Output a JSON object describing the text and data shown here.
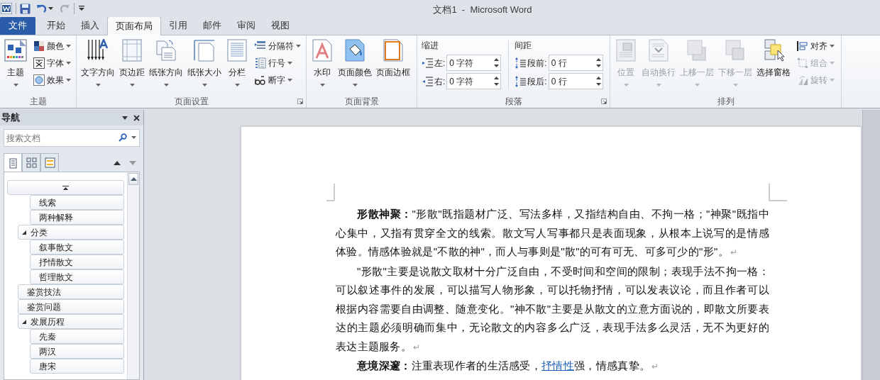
{
  "window": {
    "title": "文档1  -  Microsoft Word"
  },
  "file_tab": "文件",
  "tabs": [
    {
      "label": "开始",
      "selected": false
    },
    {
      "label": "插入",
      "selected": false
    },
    {
      "label": "页面布局",
      "selected": true
    },
    {
      "label": "引用",
      "selected": false
    },
    {
      "label": "邮件",
      "selected": false
    },
    {
      "label": "审阅",
      "selected": false
    },
    {
      "label": "视图",
      "selected": false
    }
  ],
  "ribbon": {
    "groups": [
      {
        "kind": "buttons",
        "label": "主题",
        "launcher": false,
        "buttons": [
          {
            "kind": "large",
            "label": "主题",
            "dropdown": true,
            "disabled": false
          },
          {
            "kind": "small",
            "label": "颜色",
            "dropdown": true,
            "disabled": false
          },
          {
            "kind": "small",
            "label": "字体",
            "dropdown": true,
            "disabled": false
          },
          {
            "kind": "small",
            "label": "效果",
            "dropdown": true,
            "disabled": false
          }
        ]
      },
      {
        "kind": "buttons",
        "label": "页面设置",
        "launcher": true,
        "buttons": [
          {
            "kind": "large",
            "label": "文字方向",
            "dropdown": true,
            "disabled": false
          },
          {
            "kind": "large",
            "label": "页边距",
            "dropdown": true,
            "disabled": false
          },
          {
            "kind": "large",
            "label": "纸张方向",
            "dropdown": true,
            "disabled": false
          },
          {
            "kind": "large",
            "label": "纸张大小",
            "dropdown": true,
            "disabled": false
          },
          {
            "kind": "large",
            "label": "分栏",
            "dropdown": true,
            "disabled": false
          },
          {
            "kind": "small",
            "label": "分隔符",
            "dropdown": true,
            "disabled": false
          },
          {
            "kind": "small",
            "label": "行号",
            "dropdown": true,
            "disabled": false
          },
          {
            "kind": "small",
            "label": "断字",
            "dropdown": true,
            "disabled": false
          }
        ]
      },
      {
        "kind": "buttons",
        "label": "页面背景",
        "launcher": false,
        "buttons": [
          {
            "kind": "large",
            "label": "水印",
            "dropdown": true,
            "disabled": false
          },
          {
            "kind": "large",
            "label": "页面颜色",
            "dropdown": true,
            "disabled": false
          },
          {
            "kind": "large",
            "label": "页面边框",
            "dropdown": false,
            "disabled": false
          }
        ]
      },
      {
        "kind": "paragraph",
        "label": "段落",
        "launcher": true,
        "sections": [
          {
            "heading": "缩进",
            "fields": [
              {
                "label": "左:",
                "value": "0 字符"
              },
              {
                "label": "右:",
                "value": "0 字符"
              }
            ]
          },
          {
            "heading": "间距",
            "fields": [
              {
                "label": "段前:",
                "value": "0 行"
              },
              {
                "label": "段后:",
                "value": "0 行"
              }
            ]
          }
        ]
      },
      {
        "kind": "buttons",
        "label": "排列",
        "launcher": false,
        "buttons": [
          {
            "kind": "large",
            "label": "位置",
            "dropdown": true,
            "disabled": true
          },
          {
            "kind": "large",
            "label": "自动换行",
            "dropdown": true,
            "disabled": true
          },
          {
            "kind": "large",
            "label": "上移一层",
            "dropdown": true,
            "disabled": true
          },
          {
            "kind": "large",
            "label": "下移一层",
            "dropdown": true,
            "disabled": true
          },
          {
            "kind": "large",
            "label": "选择窗格",
            "dropdown": false,
            "disabled": false
          },
          {
            "kind": "small",
            "label": "对齐",
            "dropdown": true,
            "disabled": false
          },
          {
            "kind": "small",
            "label": "组合",
            "dropdown": true,
            "disabled": true
          },
          {
            "kind": "small",
            "label": "旋转",
            "dropdown": true,
            "disabled": true
          }
        ]
      }
    ]
  },
  "navigation": {
    "title": "导航",
    "search": {
      "placeholder": "搜索文档"
    },
    "view_tabs": [
      {
        "selected": true
      },
      {
        "selected": false
      },
      {
        "selected": false
      }
    ],
    "tree": [
      {
        "children": [
          {
            "label": "线索"
          },
          {
            "label": "两种解释"
          }
        ]
      },
      {
        "label": "分类",
        "expanded": true,
        "children": [
          {
            "label": "叙事散文"
          },
          {
            "label": "抒情散文"
          },
          {
            "label": "哲理散文"
          }
        ]
      },
      {
        "label": "鉴赏技法"
      },
      {
        "label": "鉴赏问题"
      },
      {
        "label": "发展历程",
        "expanded": true,
        "children": [
          {
            "label": "先秦"
          },
          {
            "label": "两汉"
          },
          {
            "label": "唐宋"
          }
        ]
      }
    ]
  },
  "document": {
    "paragraphs": [
      {
        "parts": [
          {
            "kind": "bold",
            "text": "形散神聚："
          },
          {
            "kind": "plain",
            "text": "\"形散\"既指题材广泛、写法多样，又指结构自由、不拘一格；\"神聚\"既指中心集中，又指有贯穿全文的线索。散文写人写事都只是表面现象，从根本上说写的是情感体验。情感体验就是\"不散的神\"，而人与事则是\"散\"的可有可无、可多可少的\"形\"。"
          },
          {
            "kind": "mark",
            "text": "↵"
          }
        ]
      },
      {
        "parts": [
          {
            "kind": "plain",
            "text": "\"形散\"主要是说散文取材十分广泛自由，不受时间和空间的限制；表现手法不拘一格：可以叙述事件的发展，可以描写人物形象，可以托物抒情，可以发表议论，而且作者可以根据内容需要自由调整、随意变化。\"神不散\"主要是从散文的立意方面说的，即散文所要表达的主题必须明确而集中，无论散文的内容多么广泛，表现手法多么灵活，无不为更好的表达主题服务。"
          },
          {
            "kind": "mark",
            "text": "↵"
          }
        ]
      },
      {
        "parts": [
          {
            "kind": "bold",
            "text": "意境深邃："
          },
          {
            "kind": "plain",
            "text": "注重表现作者的生活感受，"
          },
          {
            "kind": "link",
            "text": "抒情性"
          },
          {
            "kind": "plain",
            "text": "强，情感真挚。"
          },
          {
            "kind": "mark",
            "text": "↵"
          }
        ]
      }
    ]
  }
}
